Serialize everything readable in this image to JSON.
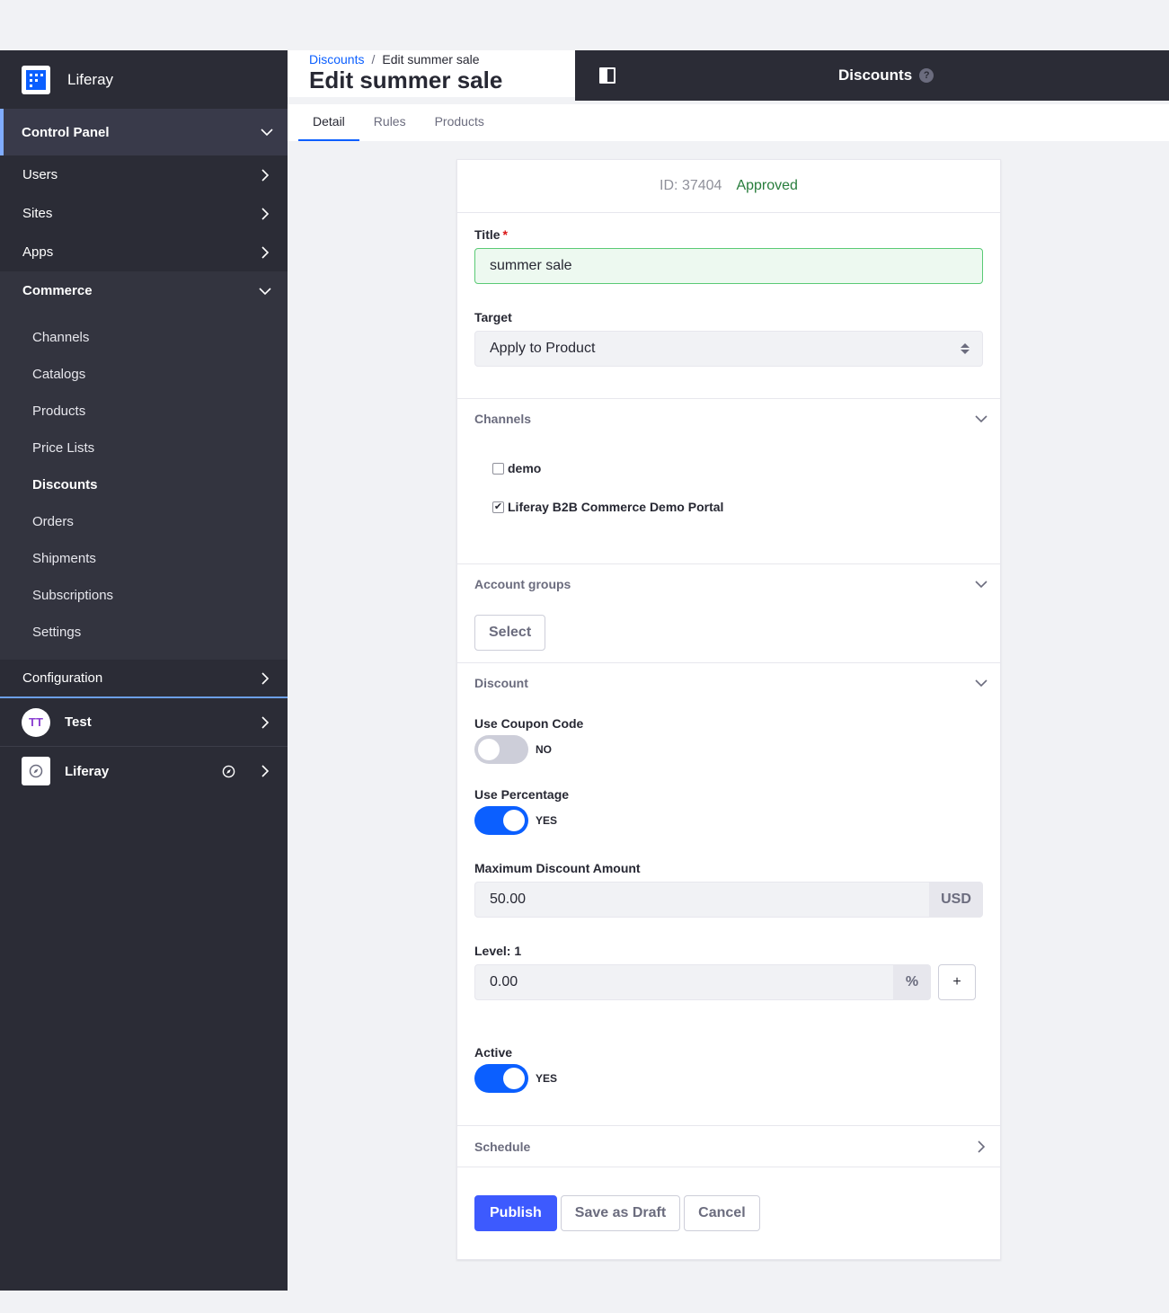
{
  "brand": {
    "name": "Liferay"
  },
  "sidebar": {
    "control_panel": "Control Panel",
    "top_items": [
      {
        "label": "Users"
      },
      {
        "label": "Sites"
      },
      {
        "label": "Apps"
      }
    ],
    "commerce": {
      "label": "Commerce",
      "items": [
        {
          "label": "Channels"
        },
        {
          "label": "Catalogs"
        },
        {
          "label": "Products"
        },
        {
          "label": "Price Lists"
        },
        {
          "label": "Discounts"
        },
        {
          "label": "Orders"
        },
        {
          "label": "Shipments"
        },
        {
          "label": "Subscriptions"
        },
        {
          "label": "Settings"
        }
      ],
      "active_item": "Discounts"
    },
    "configuration": "Configuration",
    "sites": [
      {
        "initials": "TT",
        "label": "Test"
      },
      {
        "label": "Liferay"
      }
    ]
  },
  "header": {
    "breadcrumb_link": "Discounts",
    "breadcrumb_sep": "/",
    "breadcrumb_current": "Edit summer sale",
    "title": "Edit summer sale",
    "topbar_title": "Discounts",
    "help_glyph": "?"
  },
  "tabs": [
    {
      "label": "Detail"
    },
    {
      "label": "Rules"
    },
    {
      "label": "Products"
    }
  ],
  "form": {
    "id_text": "ID: 37404",
    "status": "Approved",
    "title_label": "Title",
    "required_mark": "*",
    "title_value": "summer sale",
    "target_label": "Target",
    "target_value": "Apply to Product",
    "channels_label": "Channels",
    "channels": [
      {
        "label": "demo",
        "checked": false
      },
      {
        "label": "Liferay B2B Commerce Demo Portal",
        "checked": true
      }
    ],
    "check_glyph": "✔",
    "account_groups_label": "Account groups",
    "select_button": "Select",
    "discount_label": "Discount",
    "use_coupon_label": "Use Coupon Code",
    "use_coupon_state": "NO",
    "use_percentage_label": "Use Percentage",
    "use_percentage_state": "YES",
    "max_discount_label": "Maximum Discount Amount",
    "max_discount_value": "50.00",
    "currency": "USD",
    "level_label": "Level: 1",
    "level_value": "0.00",
    "percent_sign": "%",
    "plus_glyph": "+",
    "active_label": "Active",
    "active_state": "YES",
    "schedule_label": "Schedule",
    "publish_button": "Publish",
    "save_draft_button": "Save as Draft",
    "cancel_button": "Cancel"
  },
  "colors": {
    "primary": "#3d5afe",
    "approved": "#287d3c",
    "sidebar_bg": "#2b2c36"
  }
}
